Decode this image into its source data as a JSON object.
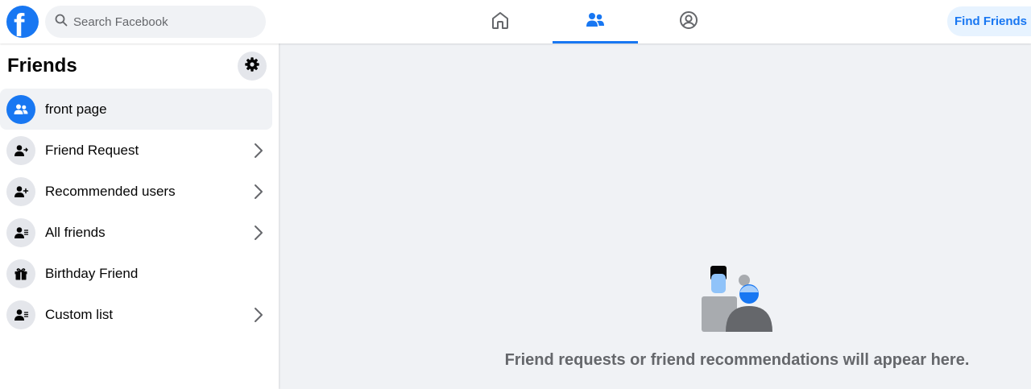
{
  "header": {
    "logo": "f",
    "search_placeholder": "Search Facebook",
    "nav_tabs": [
      "home-icon",
      "friends-icon",
      "profile-icon"
    ],
    "active_tab": "friends",
    "find_friends_label": "Find Friends"
  },
  "sidebar": {
    "title": "Friends",
    "settings_icon": "gear-icon",
    "items": [
      {
        "label": "front page",
        "icon": "people-icon",
        "active": true,
        "chevron": false
      },
      {
        "label": "Friend Request",
        "icon": "person-arrow-icon",
        "active": false,
        "chevron": true
      },
      {
        "label": "Recommended users",
        "icon": "person-plus-icon",
        "active": false,
        "chevron": true
      },
      {
        "label": "All friends",
        "icon": "person-list-icon",
        "active": false,
        "chevron": true
      },
      {
        "label": "Birthday Friend",
        "icon": "gift-icon",
        "active": false,
        "chevron": false
      },
      {
        "label": "Custom list",
        "icon": "person-list-icon",
        "active": false,
        "chevron": true
      }
    ]
  },
  "main": {
    "empty_message": "Friend requests or friend recommendations will appear here."
  },
  "colors": {
    "brand": "#1877f2",
    "background": "#f0f2f5",
    "muted_text": "#65676b"
  }
}
